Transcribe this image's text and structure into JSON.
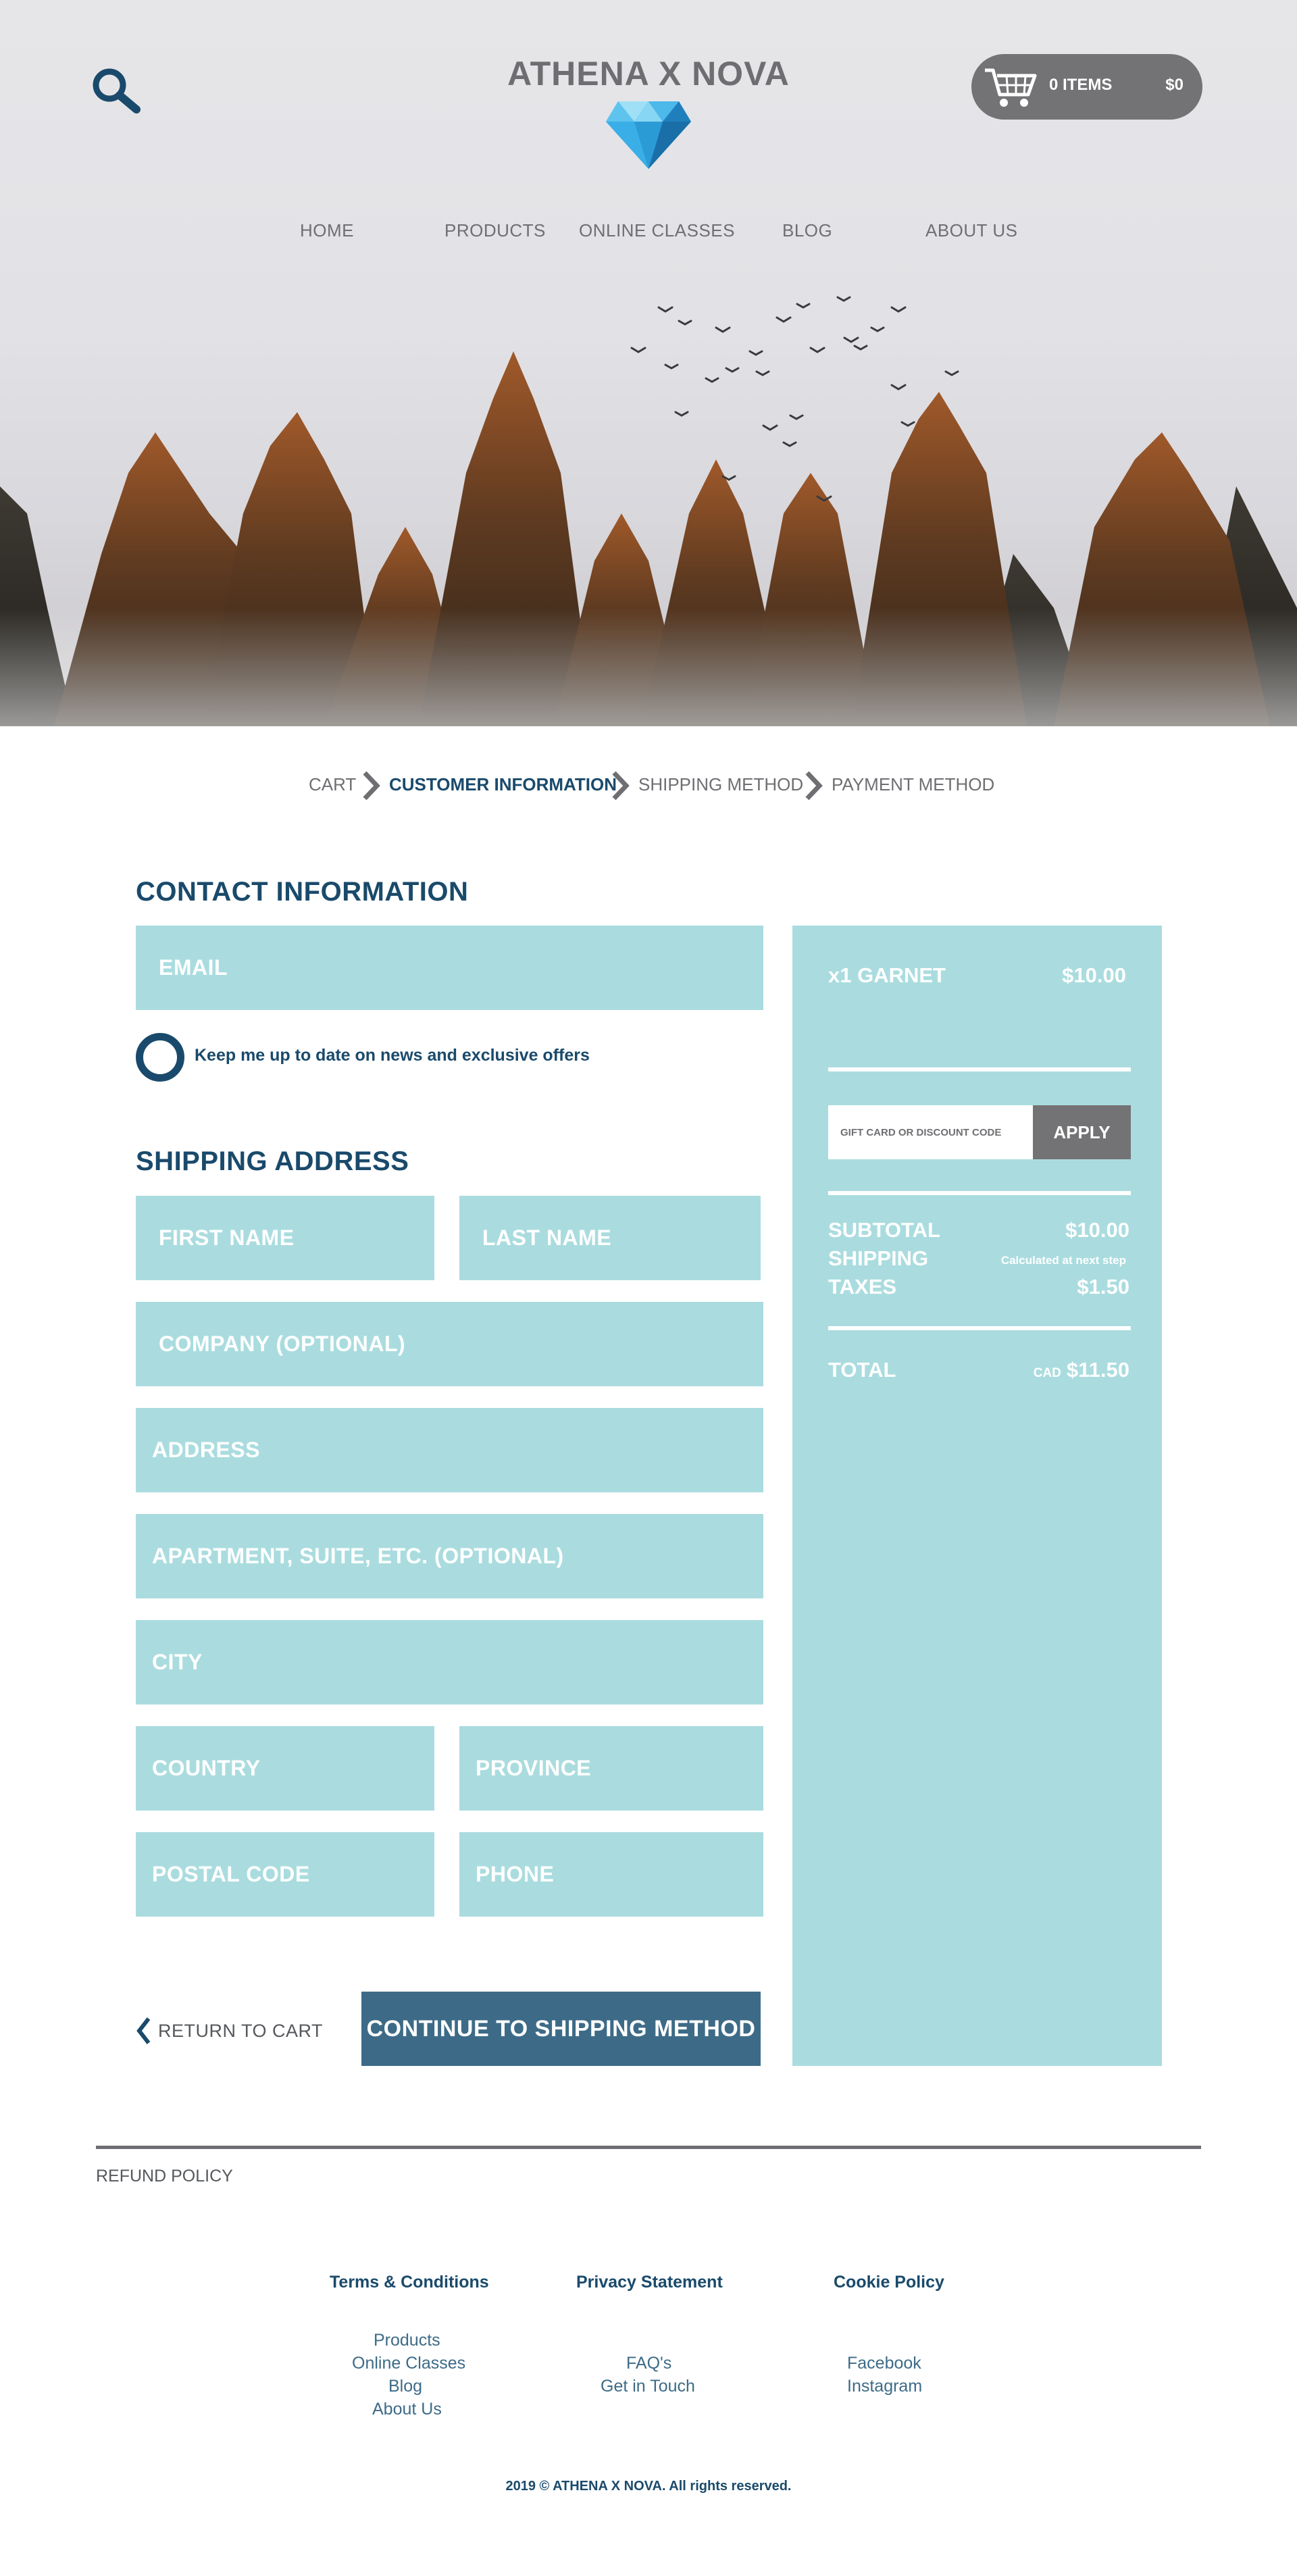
{
  "header": {
    "brand_name": "ATHENA X NOVA",
    "cart_items": "0 ITEMS",
    "cart_total": "$0",
    "nav": [
      "HOME",
      "PRODUCTS",
      "ONLINE CLASSES",
      "BLOG",
      "ABOUT US"
    ]
  },
  "breadcrumb": [
    "CART",
    "CUSTOMER INFORMATION",
    "SHIPPING METHOD",
    "PAYMENT METHOD"
  ],
  "contact": {
    "title": "CONTACT INFORMATION",
    "email_placeholder": "EMAIL",
    "newsletter_label": "Keep me up to date on news and exclusive offers"
  },
  "shipping": {
    "title": "SHIPPING ADDRESS",
    "first_name": "FIRST NAME",
    "last_name": "LAST NAME",
    "company": "COMPANY (OPTIONAL)",
    "address": "ADDRESS",
    "apartment": "APARTMENT, SUITE, ETC. (OPTIONAL)",
    "city": "CITY",
    "country": "COUNTRY",
    "province": "PROVINCE",
    "postal_code": "POSTAL CODE",
    "phone": "PHONE"
  },
  "actions": {
    "return_label": "RETURN TO CART",
    "continue_label": "CONTINUE TO SHIPPING METHOD"
  },
  "summary": {
    "item_name": "x1 GARNET",
    "item_price": "$10.00",
    "discount_placeholder": "GIFT CARD OR DISCOUNT CODE",
    "apply_label": "APPLY",
    "subtotal_label": "SUBTOTAL",
    "subtotal_value": "$10.00",
    "shipping_label": "SHIPPING",
    "shipping_value": "Calculated at next step",
    "taxes_label": "TAXES",
    "taxes_value": "$1.50",
    "total_label": "TOTAL",
    "total_currency": "CAD",
    "total_value": "$11.50"
  },
  "footer": {
    "refund_policy": "REFUND POLICY",
    "columns": [
      {
        "title": "Terms & Conditions",
        "links": [
          "Products",
          "Online Classes",
          "Blog",
          "About Us"
        ]
      },
      {
        "title": "Privacy Statement",
        "links": [
          "FAQ's",
          "Get in Touch"
        ]
      },
      {
        "title": "Cookie Policy",
        "links": [
          "Facebook",
          "Instagram"
        ]
      }
    ],
    "copyright": "2019  © ATHENA X NOVA. All rights reserved."
  },
  "colors": {
    "accent_dark": "#1a4a6b",
    "field_fill": "#aadcdf",
    "button_fill": "#3d6b87",
    "grey_pill": "#737375"
  },
  "icons": [
    "search-icon",
    "diamond-icon",
    "cart-icon",
    "chevron-right-icon",
    "chevron-left-icon"
  ]
}
